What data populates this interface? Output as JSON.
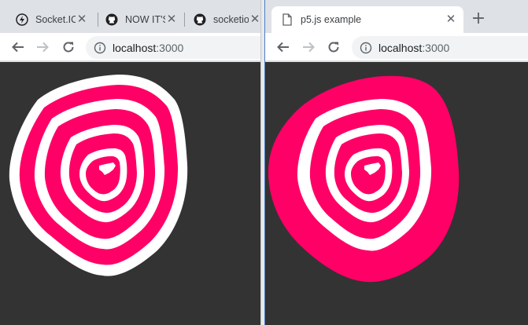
{
  "left_window": {
    "tabs": [
      {
        "title": "Socket.IO",
        "favicon": "socketio-icon"
      },
      {
        "title": "NOW IT'S",
        "favicon": "github-icon"
      },
      {
        "title": "socketio",
        "favicon": "github-icon"
      }
    ],
    "url": {
      "host": "localhost",
      "port": ":3000"
    }
  },
  "right_window": {
    "tabs": [
      {
        "title": "p5.js example",
        "favicon": "page-icon"
      }
    ],
    "url": {
      "host": "localhost",
      "port": ":3000"
    }
  },
  "canvas": {
    "background": "#333333",
    "stroke_colors": {
      "left_outer": "#ffffff",
      "fill": "#ff0066"
    }
  },
  "colors": {
    "tabstrip": "#dee1e6",
    "toolbar": "#ffffff",
    "omnibox": "#f1f3f4"
  }
}
